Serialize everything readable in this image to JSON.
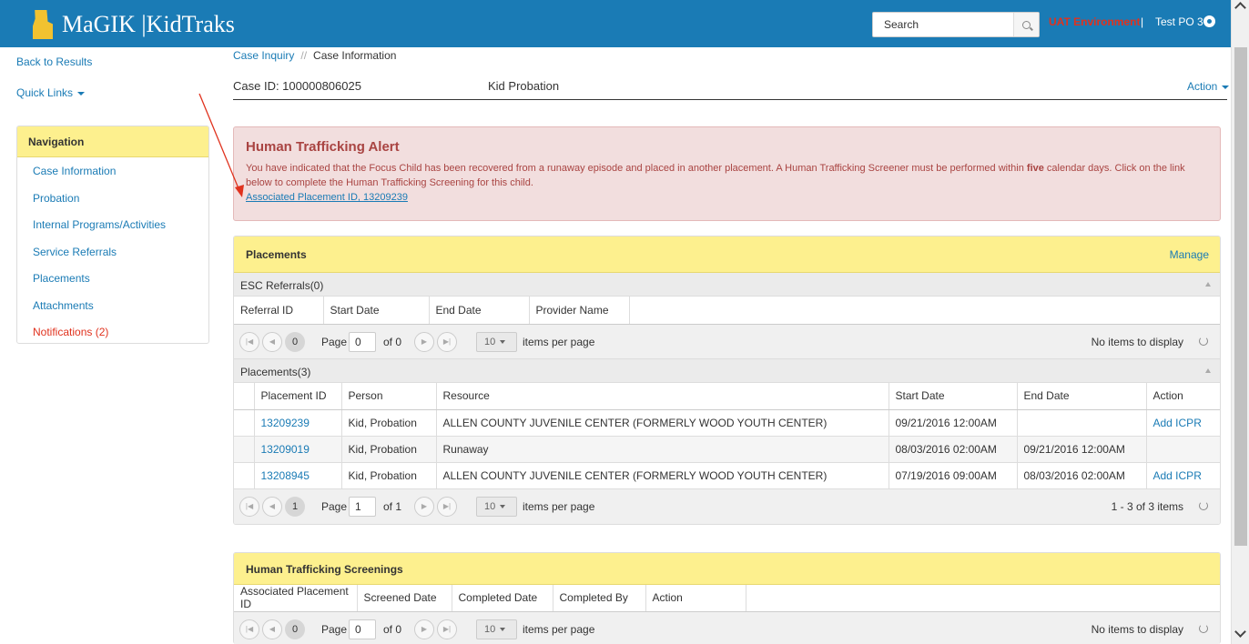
{
  "header": {
    "brand": "MaGIK |KidTraks",
    "search_placeholder": "Search",
    "environment": "UAT Environment",
    "separator": "|",
    "user": "Test PO 3"
  },
  "left": {
    "back_link": "Back to Results",
    "quick_links": "Quick Links",
    "nav": {
      "title": "Navigation",
      "items": [
        "Case Information",
        "Probation",
        "Internal Programs/Activities",
        "Service Referrals",
        "Placements",
        "Attachments",
        "Notifications (2)"
      ]
    }
  },
  "breadcrumb": {
    "root": "Case Inquiry",
    "sep": "//",
    "current": "Case Information"
  },
  "case": {
    "id_text": "Case ID: 100000806025",
    "type": "Kid Probation",
    "action": "Action"
  },
  "alert": {
    "title": "Human Trafficking Alert",
    "text_before": "You have indicated that the Focus Child has been recovered from a runaway episode and placed in another placement. A Human Trafficking Screener must be performed within ",
    "text_bold": "five",
    "text_after": " calendar days. Click on the link below to complete the Human Trafficking Screening for this child.",
    "link": "Associated Placement ID, 13209239"
  },
  "placements_panel": {
    "title": "Placements",
    "manage": "Manage",
    "esc": {
      "group_title": "ESC Referrals(0)",
      "columns": [
        "Referral ID",
        "Start Date",
        "End Date",
        "Provider Name"
      ],
      "pager": {
        "current": "0",
        "page_label": "Page",
        "page_input": "0",
        "of": "of 0",
        "per_page": "10",
        "per_page_label": "items per page",
        "status": "No items to display"
      }
    },
    "placements": {
      "group_title": "Placements(3)",
      "columns": [
        "Placement ID",
        "Person",
        "Resource",
        "Start Date",
        "End Date",
        "Action"
      ],
      "rows": [
        {
          "id": "13209239",
          "person": "Kid, Probation",
          "resource": "ALLEN COUNTY JUVENILE CENTER (FORMERLY WOOD YOUTH CENTER)",
          "start": "09/21/2016 12:00AM",
          "end": "",
          "action": "Add ICPR"
        },
        {
          "id": "13209019",
          "person": "Kid, Probation",
          "resource": "Runaway",
          "start": "08/03/2016 02:00AM",
          "end": "09/21/2016 12:00AM",
          "action": ""
        },
        {
          "id": "13208945",
          "person": "Kid, Probation",
          "resource": "ALLEN COUNTY JUVENILE CENTER (FORMERLY WOOD YOUTH CENTER)",
          "start": "07/19/2016 09:00AM",
          "end": "08/03/2016 02:00AM",
          "action": "Add ICPR"
        }
      ],
      "pager": {
        "current": "1",
        "page_label": "Page",
        "page_input": "1",
        "of": "of 1",
        "per_page": "10",
        "per_page_label": "items per page",
        "status": "1 - 3 of 3 items"
      }
    }
  },
  "screenings_panel": {
    "title": "Human Trafficking Screenings",
    "columns": [
      "Associated Placement ID",
      "Screened Date",
      "Completed Date",
      "Completed By",
      "Action"
    ],
    "pager": {
      "current": "0",
      "page_label": "Page",
      "page_input": "0",
      "of": "of 0",
      "per_page": "10",
      "per_page_label": "items per page",
      "status": "No items to display"
    }
  },
  "colors": {
    "header_blue": "#1a7bb5",
    "panel_yellow": "#fdf08e",
    "alert_bg": "#f2dede",
    "alert_text": "#a94442",
    "env_red": "#e0321e"
  }
}
